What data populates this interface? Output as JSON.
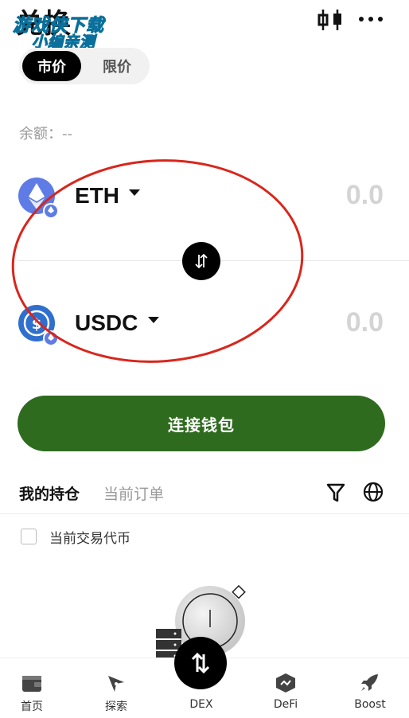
{
  "header": {
    "title": "兑换",
    "watermark_line1": "游戏侠下载",
    "watermark_line2": "小编亲测"
  },
  "mode_tabs": [
    {
      "label": "市价",
      "active": true
    },
    {
      "label": "限价",
      "active": false
    }
  ],
  "balance": {
    "label": "余额：--"
  },
  "from_token": {
    "symbol": "ETH",
    "amount": "0.0",
    "icon": "ethereum-icon"
  },
  "to_token": {
    "symbol": "USDC",
    "amount": "0.0",
    "icon": "usdc-icon"
  },
  "connect_button": {
    "label": "连接钱包",
    "color": "#2e6b1f"
  },
  "positions_tabs": [
    {
      "label": "我的持仓",
      "active": true
    },
    {
      "label": "当前订单",
      "active": false
    }
  ],
  "filter": {
    "checkbox_label": "当前交易代币",
    "checked": false
  },
  "bottom_nav": [
    {
      "label": "首页",
      "icon": "wallet-icon"
    },
    {
      "label": "探索",
      "icon": "compass-icon"
    },
    {
      "label": "DEX",
      "icon": "swap-icon"
    },
    {
      "label": "DeFi",
      "icon": "defi-icon"
    },
    {
      "label": "Boost",
      "icon": "rocket-icon"
    }
  ]
}
